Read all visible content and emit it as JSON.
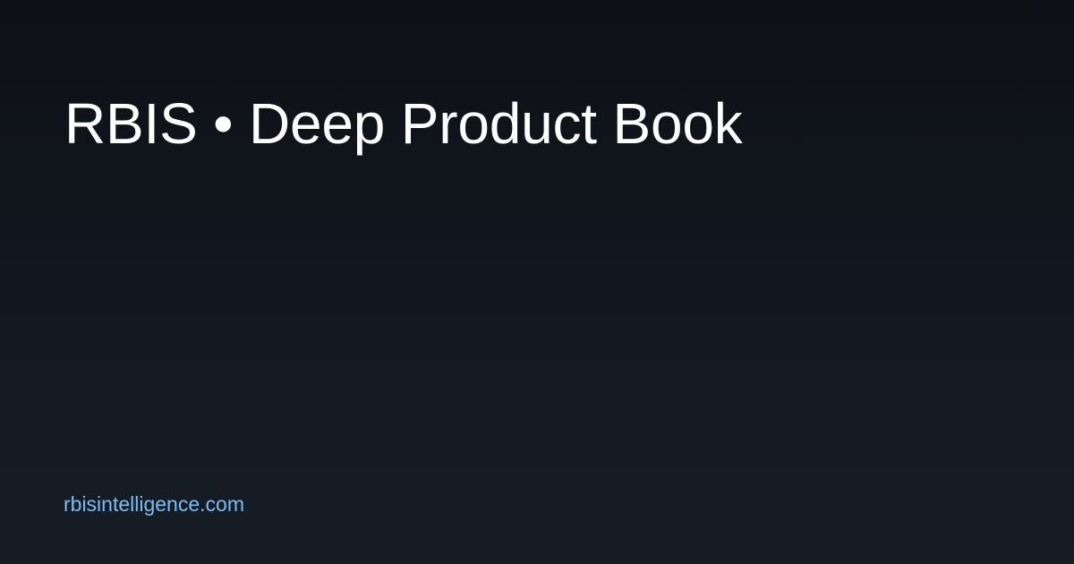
{
  "card": {
    "title": "RBIS • Deep Product Book",
    "site_url": "rbisintelligence.com"
  },
  "colors": {
    "background_top": "#0d1015",
    "background_bottom": "#171d25",
    "title": "#ffffff",
    "link": "#79bdf7"
  }
}
